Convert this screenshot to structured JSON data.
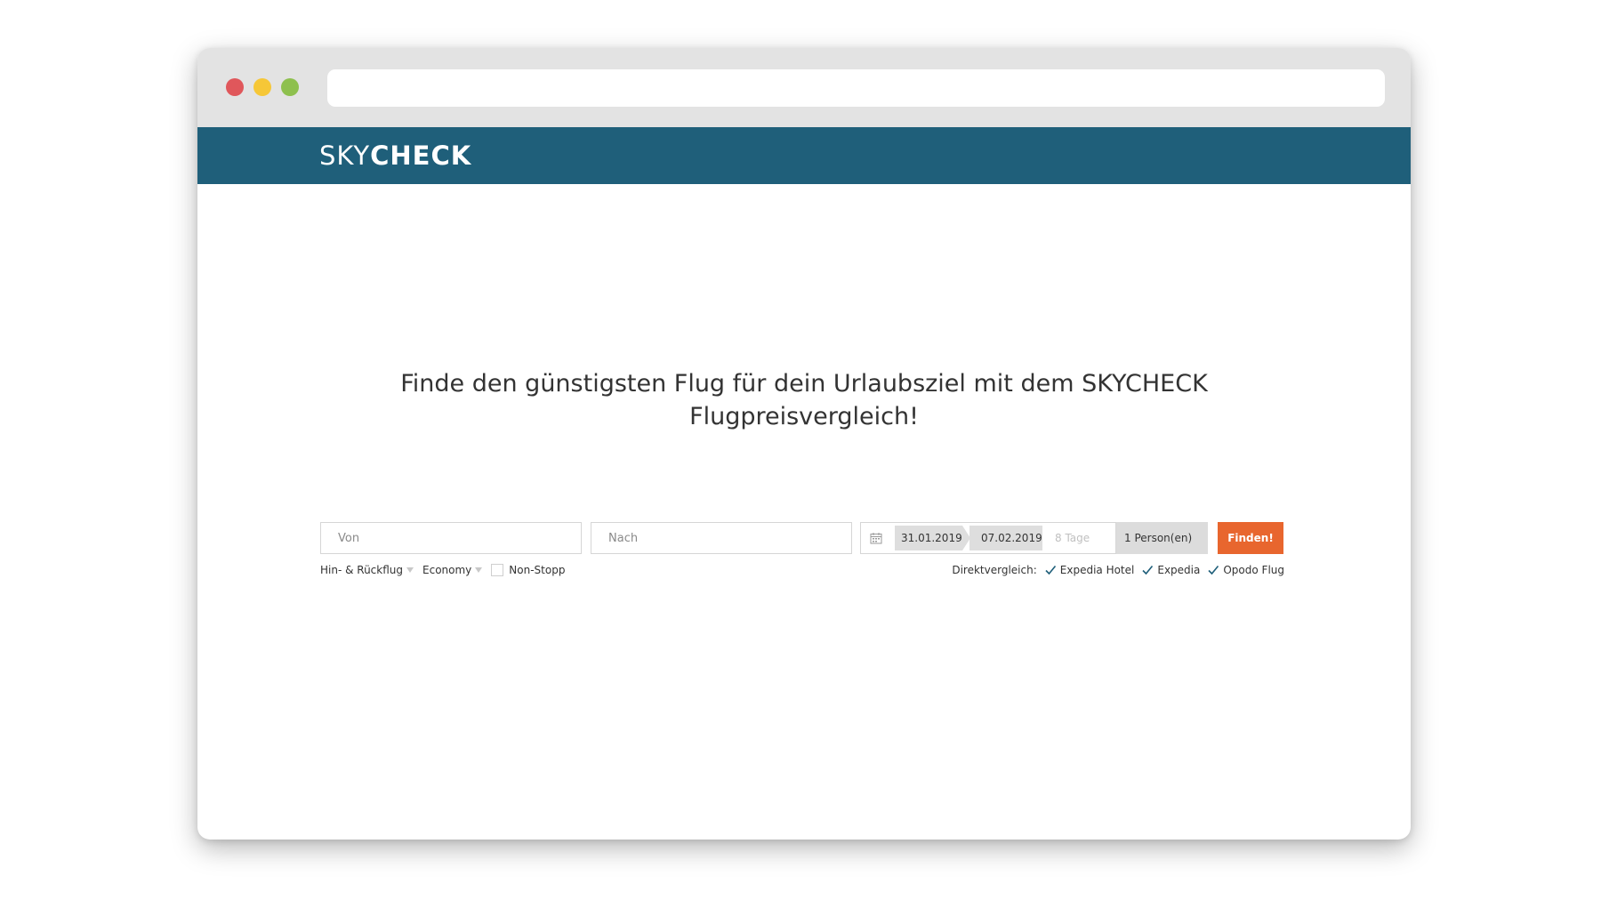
{
  "colors": {
    "header_bg": "#1f5f7a",
    "accent": "#e8662e",
    "dot_red": "#e0575b",
    "dot_yellow": "#f6c737",
    "dot_green": "#8ec04e",
    "check": "#1f5f7a"
  },
  "browser": {
    "address_value": ""
  },
  "header": {
    "logo_light": "SKY",
    "logo_bold": "CHECK"
  },
  "main": {
    "headline": "Finde den günstigsten Flug für dein Urlaubsziel mit dem SKYCHECK Flugpreisvergleich!"
  },
  "search": {
    "from_placeholder": "Von",
    "to_placeholder": "Nach",
    "calendar_icon": "calendar-icon",
    "start_date": "31.01.2019",
    "end_date": "07.02.2019",
    "duration": "8 Tage",
    "persons": "1 Person(en)",
    "submit_label": "Finden!"
  },
  "options": {
    "trip_type": "Hin- & Rückflug",
    "cabin_class": "Economy",
    "nonstop_label": "Non-Stopp",
    "compare_label": "Direktvergleich:",
    "compare_items": [
      {
        "label": "Expedia Hotel",
        "checked": true
      },
      {
        "label": "Expedia",
        "checked": true
      },
      {
        "label": "Opodo Flug",
        "checked": true
      }
    ]
  }
}
